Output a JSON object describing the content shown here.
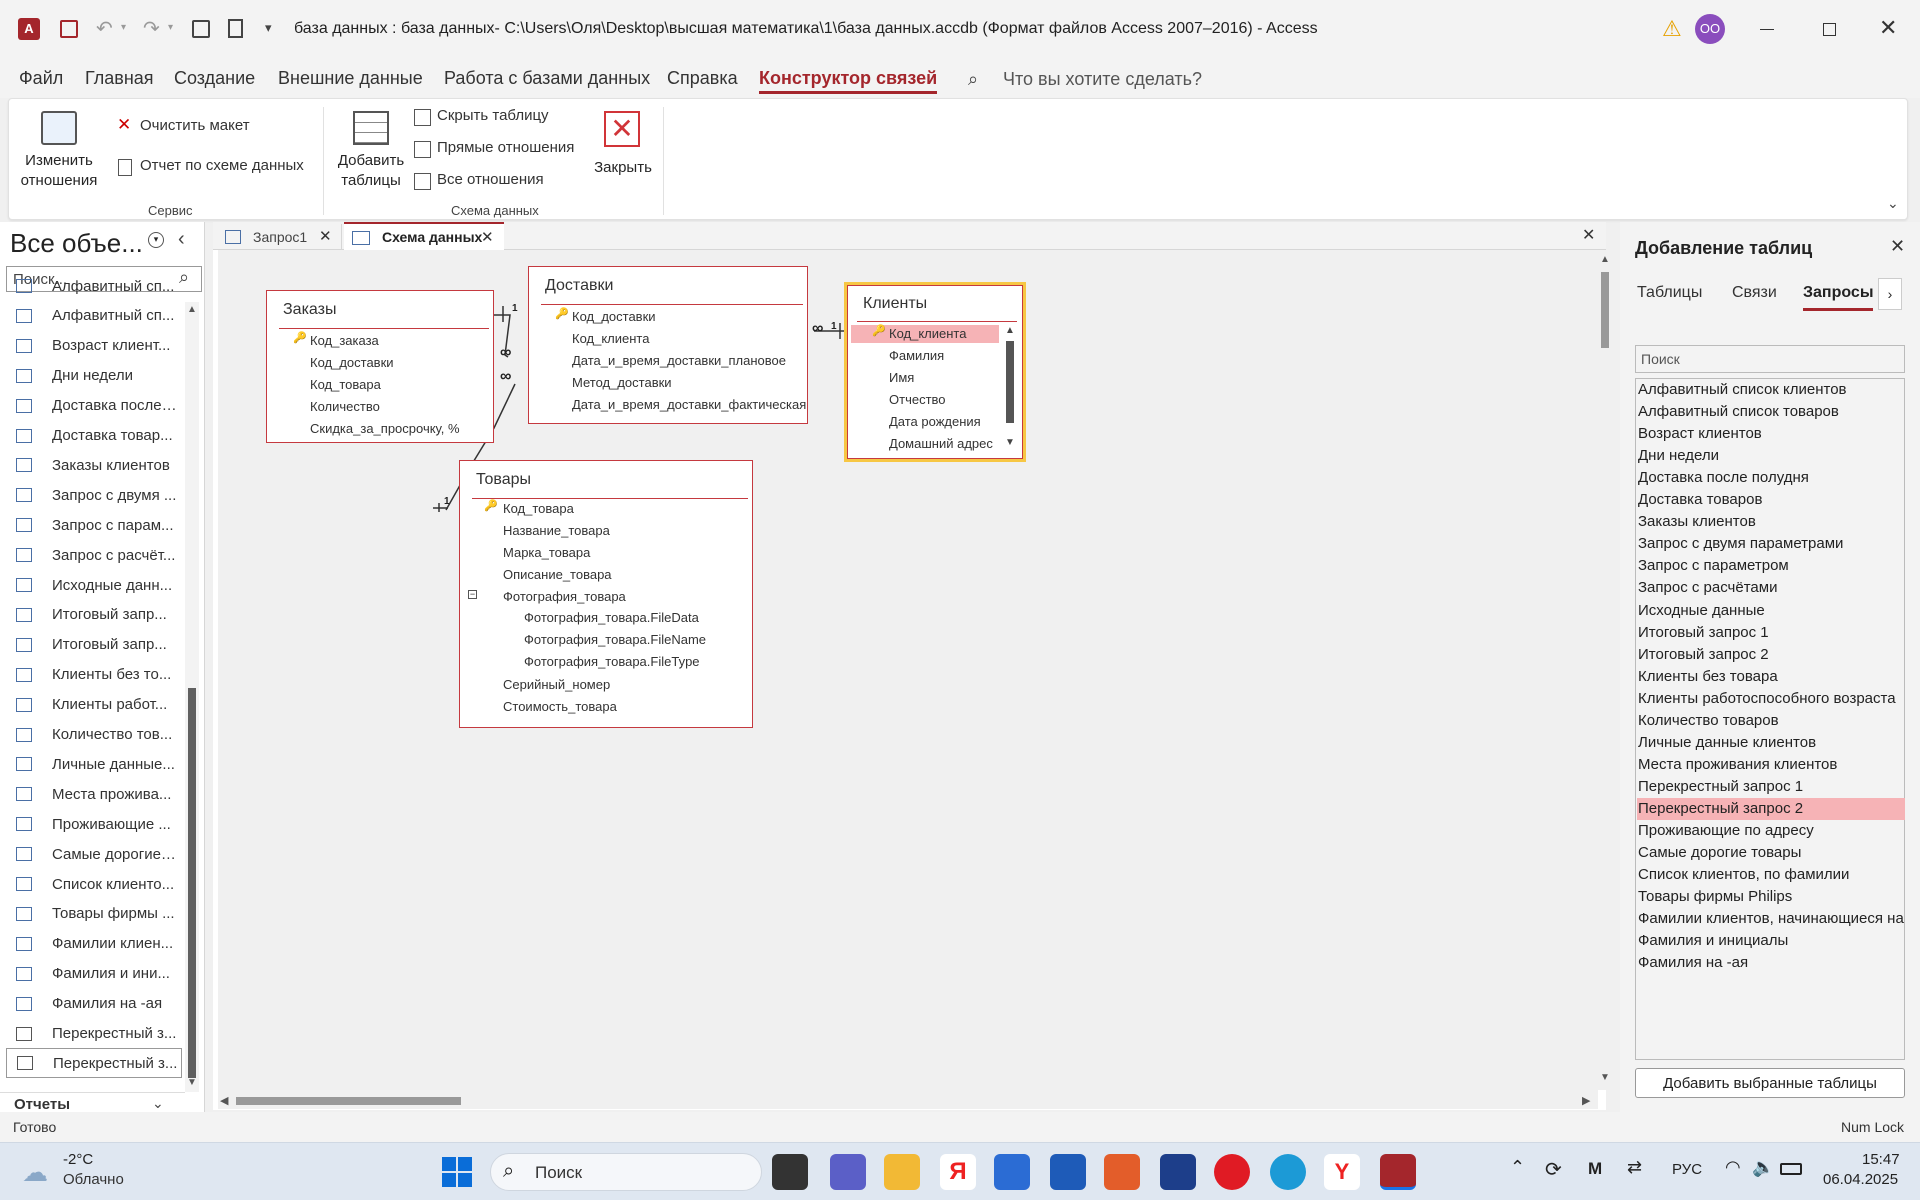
{
  "title_bar": {
    "text": "база данных : база данных- C:\\Users\\Оля\\Desktop\\высшая математика\\1\\база данных.accdb (Формат файлов Access 2007–2016)  -  Access",
    "user_initials": "OO"
  },
  "ribbon_tabs": [
    "Файл",
    "Главная",
    "Создание",
    "Внешние данные",
    "Работа с базами данных",
    "Справка",
    "Конструктор связей"
  ],
  "tell_me": "Что вы хотите сделать?",
  "ribbon": {
    "edit_rel": "Изменить\nотношения",
    "clear_layout": "Очистить макет",
    "report": "Отчет по схеме данных",
    "group_service": "Сервис",
    "add_tables": "Добавить\nтаблицы",
    "hide_table": "Скрыть таблицу",
    "direct_rel": "Прямые отношения",
    "all_rel": "Все отношения",
    "close": "Закрыть",
    "group_schema": "Схема данных"
  },
  "nav": {
    "title": "Все объе...",
    "search_placeholder": "Поиск...",
    "items": [
      "Алфавитный сп...",
      "Алфавитный сп...",
      "Возраст клиент...",
      "Дни недели",
      "Доставка после ...",
      "Доставка товар...",
      "Заказы клиентов",
      "Запрос с двумя ...",
      "Запрос с парам...",
      "Запрос с расчёт...",
      "Исходные данн...",
      "Итоговый запр...",
      "Итоговый запр...",
      "Клиенты без то...",
      "Клиенты работ...",
      "Количество тов...",
      "Личные данные...",
      "Места прожива...",
      "Проживающие ...",
      "Самые дорогие ...",
      "Список клиенто...",
      "Товары фирмы ...",
      "Фамилии клиен...",
      "Фамилия и ини...",
      "Фамилия на -ая",
      "Перекрестный з...",
      "Перекрестный з..."
    ],
    "reports_header": "Отчеты"
  },
  "doc_tabs": [
    {
      "label": "Запрос1"
    },
    {
      "label": "Схема данных"
    }
  ],
  "tables": {
    "orders": {
      "title": "Заказы",
      "fields": [
        "Код_заказа",
        "Код_доставки",
        "Код_товара",
        "Количество",
        "Скидка_за_просрочку, %"
      ]
    },
    "deliveries": {
      "title": "Доставки",
      "fields": [
        "Код_доставки",
        "Код_клиента",
        "Дата_и_время_доставки_плановое",
        "Метод_доставки",
        "Дата_и_время_доставки_фактическая"
      ]
    },
    "clients": {
      "title": "Клиенты",
      "fields": [
        "Код_клиента",
        "Фамилия",
        "Имя",
        "Отчество",
        "Дата рождения",
        "Домашний адрес"
      ]
    },
    "goods": {
      "title": "Товары",
      "fields": [
        "Код_товара",
        "Название_товара",
        "Марка_товара",
        "Описание_товара",
        "Фотография_товара",
        "Фотография_товара.FileData",
        "Фотография_товара.FileName",
        "Фотография_товара.FileType",
        "Серийный_номер",
        "Стоимость_товара"
      ]
    }
  },
  "rel_labels": {
    "one": "1",
    "many": "∞"
  },
  "right_pane": {
    "title": "Добавление таблиц",
    "tabs": [
      "Таблицы",
      "Связи",
      "Запросы"
    ],
    "search_placeholder": "Поиск",
    "queries": [
      "Алфавитный список клиентов",
      "Алфавитный список товаров",
      "Возраст клиентов",
      "Дни недели",
      "Доставка после полудня",
      "Доставка товаров",
      "Заказы клиентов",
      "Запрос с двумя параметрами",
      "Запрос с параметром",
      "Запрос с расчётами",
      "Исходные данные",
      "Итоговый запрос 1",
      "Итоговый запрос 2",
      "Клиенты без товара",
      "Клиенты работоспособного возраста",
      "Количество товаров",
      "Личные данные клиентов",
      "Места проживания клиентов",
      "Перекрестный запрос 1",
      "Перекрестный запрос 2",
      "Проживающие по адресу",
      "Самые дорогие товары",
      "Список клиентов, по фамилии",
      "Товары фирмы Philips",
      "Фамилии клиентов, начинающиеся на",
      "Фамилия и инициалы",
      "Фамилия на -ая"
    ],
    "selected_query": "Перекрестный запрос 2",
    "add_button": "Добавить выбранные таблицы"
  },
  "status": {
    "left": "Готово",
    "right": "Num Lock"
  },
  "taskbar": {
    "weather_temp": "-2°C",
    "weather_text": "Облачно",
    "search": "Поиск",
    "lang": "РУС",
    "time": "15:47",
    "date": "06.04.2025"
  },
  "colors": {
    "accent": "#a4262c",
    "table_border": "#c5393f",
    "selection": "#f6b3b6"
  }
}
